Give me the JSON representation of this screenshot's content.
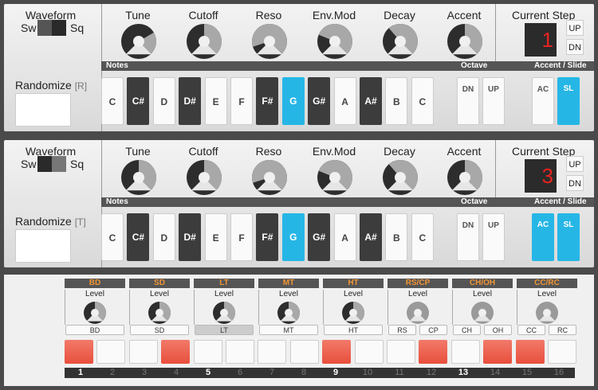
{
  "synths": [
    {
      "waveform": {
        "title": "Waveform",
        "sw": "Sw",
        "sq": "Sq",
        "selected": "Sq"
      },
      "knobs": [
        {
          "label": "Tune",
          "value": 0.72
        },
        {
          "label": "Cutoff",
          "value": 0.5
        },
        {
          "label": "Reso",
          "value": 0.1
        },
        {
          "label": "Env.Mod",
          "value": 0.25
        },
        {
          "label": "Decay",
          "value": 0.35
        },
        {
          "label": "Accent",
          "value": 0.5
        }
      ],
      "current_step": {
        "label": "Current Step",
        "value": "1",
        "up": "UP",
        "dn": "DN"
      },
      "randomize": {
        "label": "Randomize",
        "key": "[R]"
      },
      "headers": {
        "notes": "Notes",
        "octave": "Octave",
        "accent_slide": "Accent / Slide"
      },
      "notes": [
        {
          "label": "C",
          "type": "w",
          "active": false
        },
        {
          "label": "C#",
          "type": "b",
          "active": false
        },
        {
          "label": "D",
          "type": "w",
          "active": false
        },
        {
          "label": "D#",
          "type": "b",
          "active": false
        },
        {
          "label": "E",
          "type": "w",
          "active": false
        },
        {
          "label": "F",
          "type": "w",
          "active": false
        },
        {
          "label": "F#",
          "type": "b",
          "active": false
        },
        {
          "label": "G",
          "type": "w",
          "active": true
        },
        {
          "label": "G#",
          "type": "b",
          "active": false
        },
        {
          "label": "A",
          "type": "w",
          "active": false
        },
        {
          "label": "A#",
          "type": "b",
          "active": false
        },
        {
          "label": "B",
          "type": "w",
          "active": false
        },
        {
          "label": "C",
          "type": "w",
          "active": false
        }
      ],
      "octave": [
        {
          "label": "DN",
          "active": false
        },
        {
          "label": "UP",
          "active": false
        }
      ],
      "accent_slide": [
        {
          "label": "AC",
          "active": false
        },
        {
          "label": "SL",
          "active": true
        }
      ]
    },
    {
      "waveform": {
        "title": "Waveform",
        "sw": "Sw",
        "sq": "Sq",
        "selected": "Sq"
      },
      "knobs": [
        {
          "label": "Tune",
          "value": 0.5
        },
        {
          "label": "Cutoff",
          "value": 0.5
        },
        {
          "label": "Reso",
          "value": 0.1
        },
        {
          "label": "Env.Mod",
          "value": 0.25
        },
        {
          "label": "Decay",
          "value": 0.35
        },
        {
          "label": "Accent",
          "value": 0.5
        }
      ],
      "current_step": {
        "label": "Current Step",
        "value": "3",
        "up": "UP",
        "dn": "DN"
      },
      "randomize": {
        "label": "Randomize",
        "key": "[T]"
      },
      "headers": {
        "notes": "Notes",
        "octave": "Octave",
        "accent_slide": "Accent / Slide"
      },
      "notes": [
        {
          "label": "C",
          "type": "w",
          "active": false
        },
        {
          "label": "C#",
          "type": "b",
          "active": false
        },
        {
          "label": "D",
          "type": "w",
          "active": false
        },
        {
          "label": "D#",
          "type": "b",
          "active": false
        },
        {
          "label": "E",
          "type": "w",
          "active": false
        },
        {
          "label": "F",
          "type": "w",
          "active": false
        },
        {
          "label": "F#",
          "type": "b",
          "active": false
        },
        {
          "label": "G",
          "type": "w",
          "active": true
        },
        {
          "label": "G#",
          "type": "b",
          "active": false
        },
        {
          "label": "A",
          "type": "w",
          "active": false
        },
        {
          "label": "A#",
          "type": "b",
          "active": false
        },
        {
          "label": "B",
          "type": "w",
          "active": false
        },
        {
          "label": "C",
          "type": "w",
          "active": false
        }
      ],
      "octave": [
        {
          "label": "DN",
          "active": false
        },
        {
          "label": "UP",
          "active": false
        }
      ],
      "accent_slide": [
        {
          "label": "AC",
          "active": true
        },
        {
          "label": "SL",
          "active": true
        }
      ]
    }
  ],
  "drums": {
    "groups": [
      {
        "name": "BD",
        "level_label": "Level",
        "level": 0.5,
        "selectors": [
          {
            "label": "BD",
            "active": false
          }
        ]
      },
      {
        "name": "SD",
        "level_label": "Level",
        "level": 0.5,
        "selectors": [
          {
            "label": "SD",
            "active": false
          }
        ]
      },
      {
        "name": "LT",
        "level_label": "Level",
        "level": 0.5,
        "selectors": [
          {
            "label": "LT",
            "active": true
          }
        ]
      },
      {
        "name": "MT",
        "level_label": "Level",
        "level": 0.5,
        "selectors": [
          {
            "label": "MT",
            "active": false
          }
        ]
      },
      {
        "name": "HT",
        "level_label": "Level",
        "level": 0.5,
        "selectors": [
          {
            "label": "HT",
            "active": false
          }
        ]
      },
      {
        "name": "RS/CP",
        "level_label": "Level",
        "level": 0.5,
        "dim": true,
        "selectors": [
          {
            "label": "RS",
            "active": false
          },
          {
            "label": "CP",
            "active": false
          }
        ]
      },
      {
        "name": "CH/OH",
        "level_label": "Level",
        "level": 0.5,
        "dim": true,
        "selectors": [
          {
            "label": "CH",
            "active": false
          },
          {
            "label": "OH",
            "active": false
          }
        ]
      },
      {
        "name": "CC/RC",
        "level_label": "Level",
        "level": 0.5,
        "dim": true,
        "selectors": [
          {
            "label": "CC",
            "active": false
          },
          {
            "label": "RC",
            "active": false
          }
        ]
      }
    ],
    "steps": [
      true,
      false,
      false,
      true,
      false,
      false,
      false,
      false,
      true,
      false,
      false,
      true,
      false,
      true,
      true,
      false
    ],
    "step_numbers": [
      "1",
      "2",
      "3",
      "4",
      "5",
      "6",
      "7",
      "8",
      "9",
      "10",
      "11",
      "12",
      "13",
      "14",
      "15",
      "16"
    ],
    "emphasized_steps": [
      1,
      5,
      9,
      13
    ]
  },
  "colors": {
    "accent": "#26b6e6",
    "step_on": "#e84f3c",
    "display_digit": "#e8231f",
    "drum_header": "#f09433"
  }
}
